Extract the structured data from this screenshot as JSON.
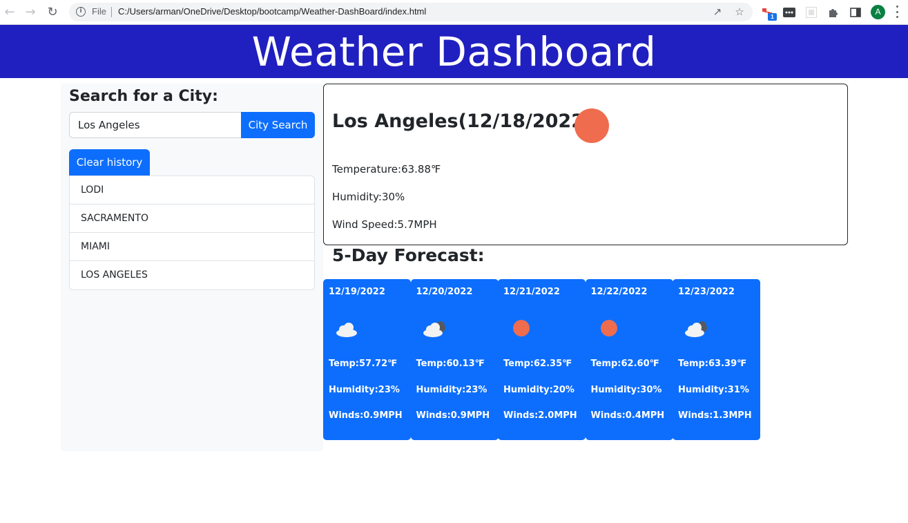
{
  "browser": {
    "file_label": "File",
    "url": "C:/Users/arman/OneDrive/Desktop/bootcamp/Weather-DashBoard/index.html",
    "extension_badge": "1",
    "profile_initial": "A"
  },
  "header": {
    "title": "Weather Dashboard"
  },
  "sidebar": {
    "heading": "Search for a City:",
    "search_value": "Los Angeles",
    "search_button": "City Search",
    "clear_button": "Clear history",
    "history": [
      "LODI",
      "SACRAMENTO",
      "MIAMI",
      "LOS ANGELES"
    ]
  },
  "current": {
    "title": "Los Angeles(12/18/2022)",
    "icon": "sun-icon",
    "temperature": "Temperature:63.88℉",
    "humidity": "Humidity:30%",
    "wind": "Wind Speed:5.7MPH"
  },
  "forecast": {
    "heading": "5-Day Forecast:",
    "days": [
      {
        "date": "12/19/2022",
        "icon": "cloud-icon",
        "temp": "Temp:57.72℉",
        "humidity": "Humidity:23%",
        "wind": "Winds:0.9MPH"
      },
      {
        "date": "12/20/2022",
        "icon": "partly-cloudy-icon",
        "temp": "Temp:60.13℉",
        "humidity": "Humidity:23%",
        "wind": "Winds:0.9MPH"
      },
      {
        "date": "12/21/2022",
        "icon": "sun-icon",
        "temp": "Temp:62.35℉",
        "humidity": "Humidity:20%",
        "wind": "Winds:2.0MPH"
      },
      {
        "date": "12/22/2022",
        "icon": "sun-icon",
        "temp": "Temp:62.60℉",
        "humidity": "Humidity:30%",
        "wind": "Winds:0.4MPH"
      },
      {
        "date": "12/23/2022",
        "icon": "partly-cloudy-icon",
        "temp": "Temp:63.39℉",
        "humidity": "Humidity:31%",
        "wind": "Winds:1.3MPH"
      }
    ]
  },
  "colors": {
    "header_bg": "#2020c0",
    "primary": "#0d6efd",
    "sun": "#ef6c4f"
  }
}
